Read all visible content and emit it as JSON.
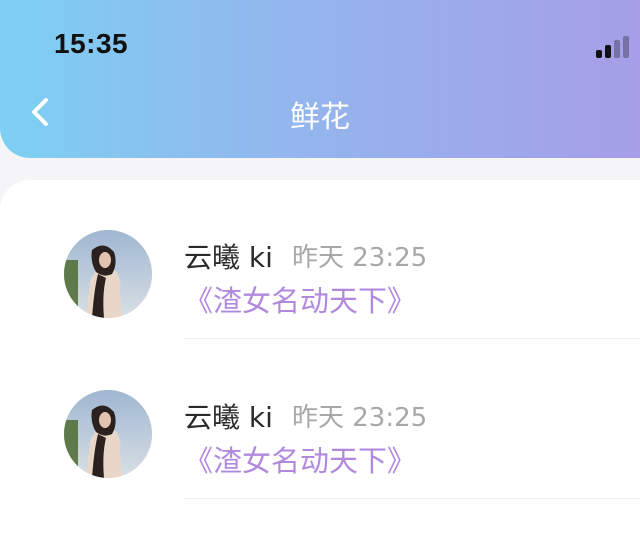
{
  "status_bar": {
    "time": "15:35",
    "signal_icon": "signal-bars-icon"
  },
  "nav": {
    "title": "鲜花",
    "back_icon": "chevron-left-icon"
  },
  "colors": {
    "header_gradient_start": "#7dd0f3",
    "header_gradient_end": "#a69ee8",
    "book_title": "#b18ae0",
    "timestamp": "#a8a8a8"
  },
  "items": [
    {
      "user": "云曦 ki",
      "time": "昨天 23:25",
      "book": "《渣女名动天下》"
    },
    {
      "user": "云曦 ki",
      "time": "昨天 23:25",
      "book": "《渣女名动天下》"
    }
  ]
}
